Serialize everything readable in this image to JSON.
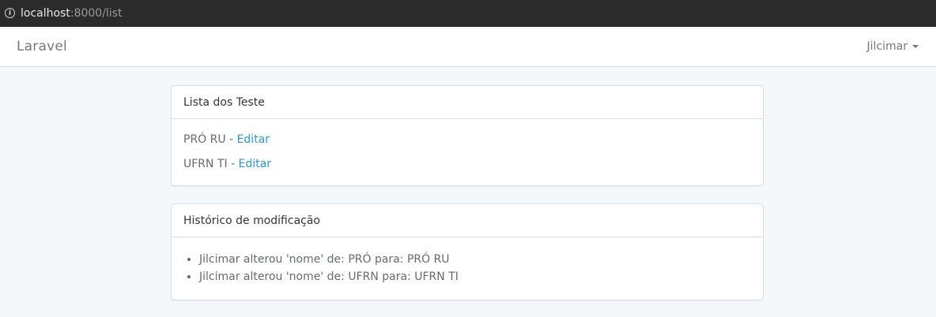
{
  "browser": {
    "url_host": "localhost",
    "url_path": ":8000/list"
  },
  "navbar": {
    "brand": "Laravel",
    "user": "Jilcimar"
  },
  "list_panel": {
    "title": "Lista dos Teste",
    "items": [
      {
        "name": "PRÓ RU",
        "separator": " - ",
        "action": "Editar"
      },
      {
        "name": "UFRN TI",
        "separator": " - ",
        "action": "Editar"
      }
    ]
  },
  "history_panel": {
    "title": "Histórico de modificação",
    "entries": [
      "Jilcimar alterou 'nome' de: PRÓ para: PRÓ RU",
      "Jilcimar alterou 'nome' de: UFRN para: UFRN TI"
    ]
  },
  "colors": {
    "link": "#3097d1",
    "background": "#f5f8fa",
    "border": "#d3e0e9"
  }
}
